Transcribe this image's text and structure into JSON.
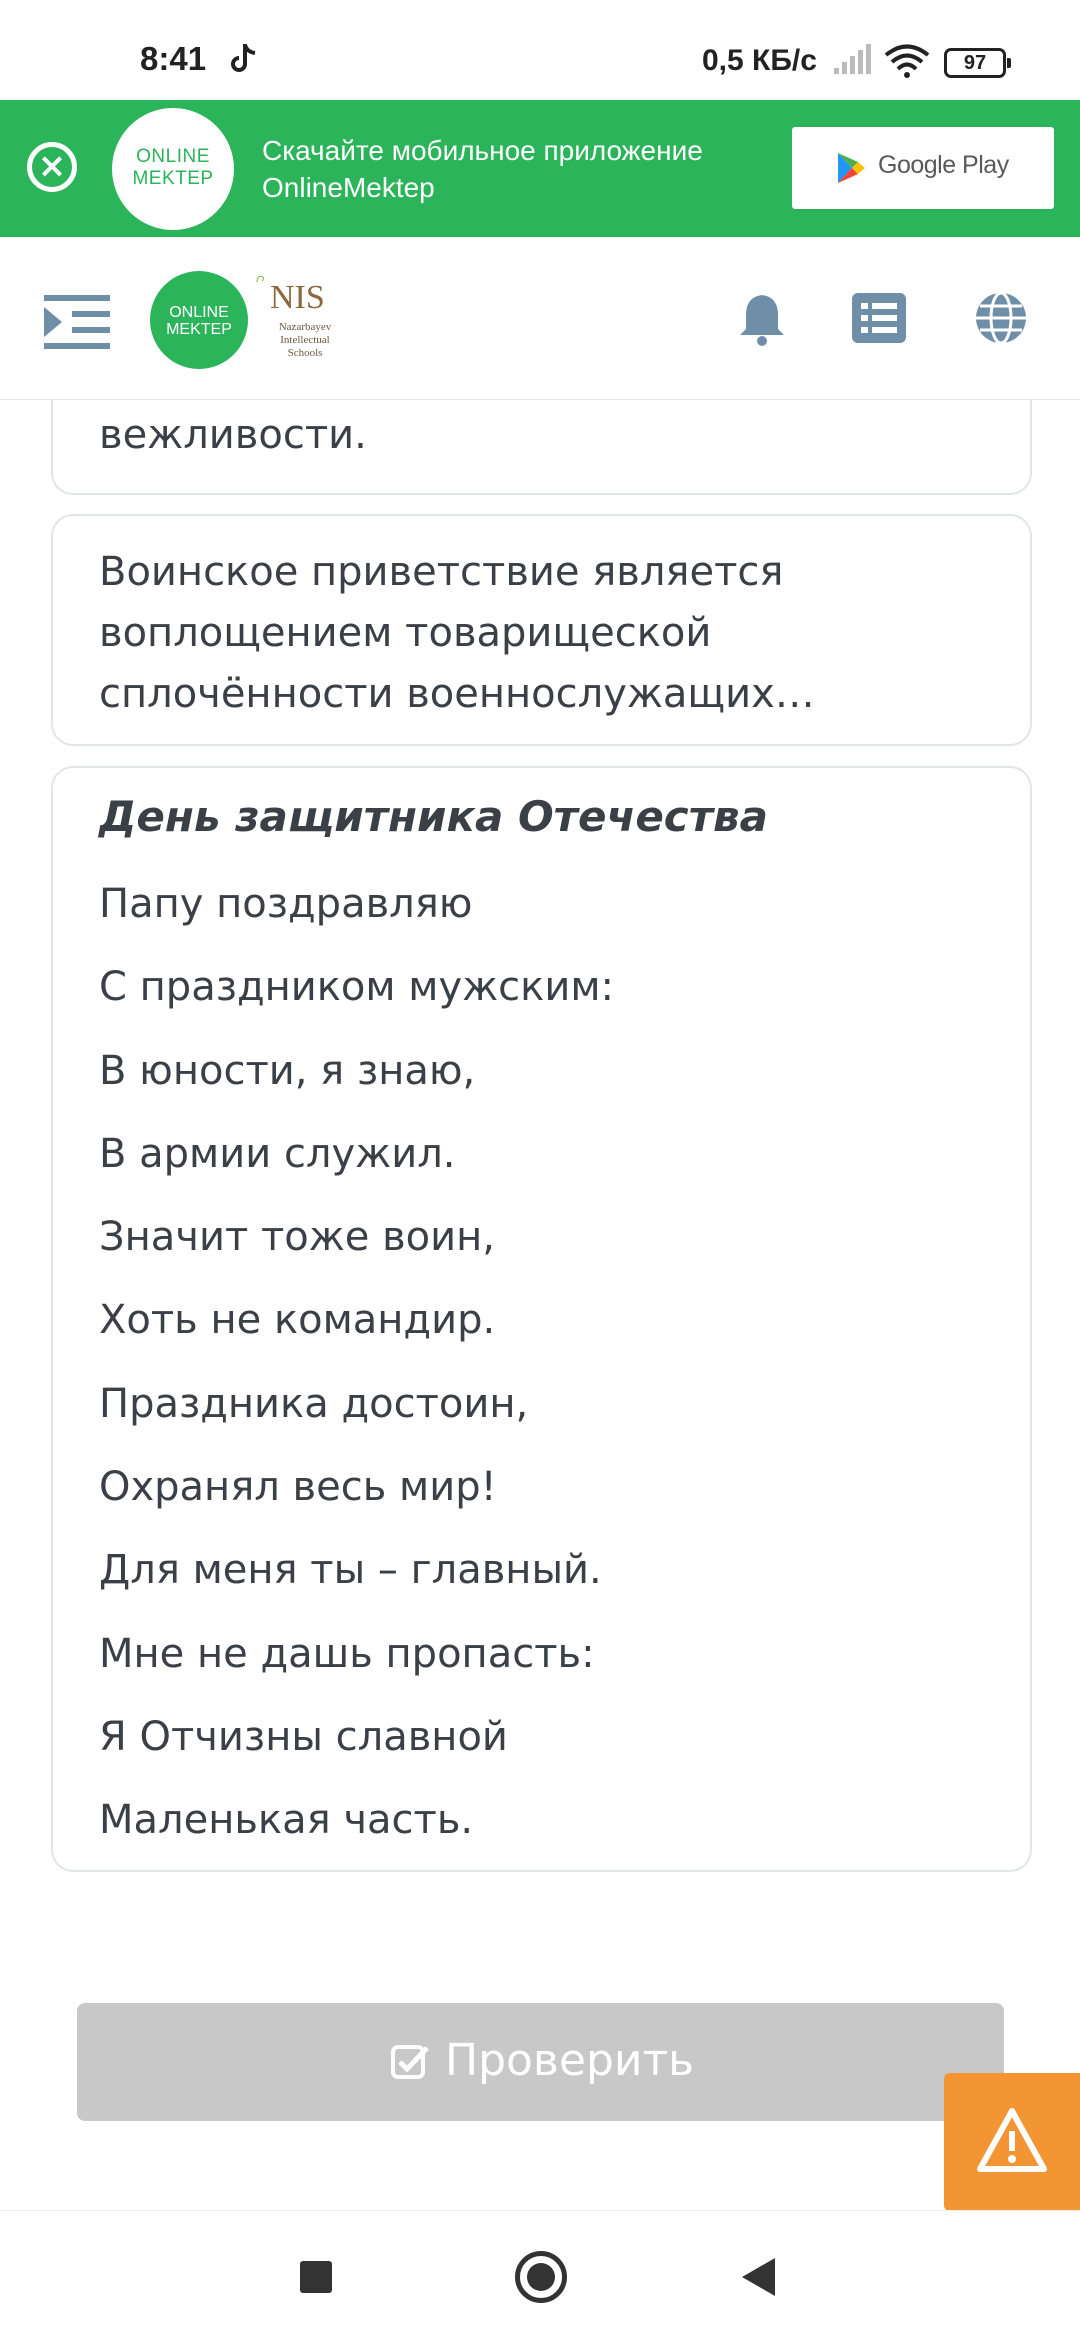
{
  "status_bar": {
    "time": "8:41",
    "net_speed": "0,5 КБ/с",
    "battery": "97",
    "icons": [
      "tiktok-icon",
      "signal-icon",
      "wifi-icon",
      "battery-icon"
    ]
  },
  "banner": {
    "logo_line1": "ONLINE",
    "logo_line2": "MEKTEP",
    "text": "Скачайте мобильное приложение OnlineMektep",
    "store_label": "Google Play"
  },
  "header": {
    "logo_line1": "ONLINE",
    "logo_line2": "MEKTEP",
    "nis_title": "NIS",
    "nis_subtitle": "Nazarbayev Intellectual Schools",
    "icons": [
      "menu-icon",
      "bell-icon",
      "list-icon",
      "globe-icon"
    ]
  },
  "cards": {
    "card1_partial_top": "…",
    "card1_text": "вежливости.",
    "card2_text": "Воинское приветствие является воплощением товарищеской сплочённости военнослужащих…",
    "poem_title": "День защитника Отечества",
    "poem_lines": [
      "Папу поздравляю",
      "С праздником мужским:",
      "В юности, я знаю,",
      "В армии служил.",
      "Значит тоже воин,",
      "Хоть не командир.",
      "Праздника достоин,",
      "Охранял весь мир!",
      "Для меня ты – главный.",
      "Мне не дашь пропасть:",
      "Я Отчизны славной",
      "Маленькая часть."
    ]
  },
  "actions": {
    "check_label": "Проверить"
  },
  "colors": {
    "brand_green": "#2cb45a",
    "button_disabled": "#c8c8c8",
    "warning_orange": "#f49534",
    "text": "#3a4046"
  }
}
